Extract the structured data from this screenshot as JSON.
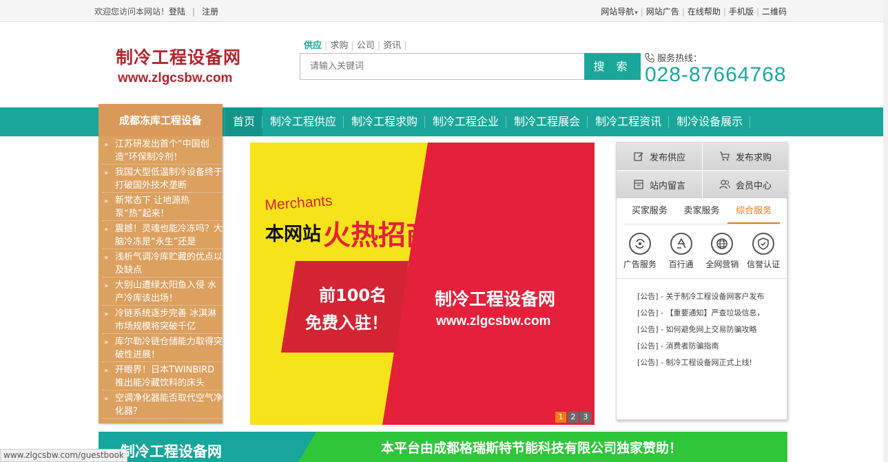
{
  "topbar": {
    "welcome": "欢迎您访问本网站！",
    "login": "登陆",
    "register": "注册",
    "links": [
      "网站导航",
      "网站广告",
      "在线帮助",
      "手机版",
      "二维码"
    ]
  },
  "logo": {
    "title": "制冷工程设备网",
    "url": "www.zlgcsbw.com"
  },
  "search": {
    "tabs": [
      "供应",
      "求购",
      "公司",
      "资讯"
    ],
    "placeholder": "请输入关键词",
    "button": "搜 索"
  },
  "hotline": {
    "label": "服务热线：",
    "number": "028-87664768"
  },
  "nav": {
    "items": [
      "首页",
      "制冷工程供应",
      "制冷工程求购",
      "制冷工程企业",
      "制冷工程展会",
      "制冷工程资讯",
      "制冷设备展示"
    ]
  },
  "sidebar": {
    "title": "成都冻库工程设备",
    "news": [
      "江苏研发出首个“中国创造”环保制冷剂！",
      "我国大型低温制冷设备终于打破国外技术垄断",
      "新常态下 让地源热泵“热”起来！",
      "震撼！灵魂也能冷冻吗？大脑冷冻是“永生”还是",
      "浅析气调冷库贮藏的优点以及缺点",
      "大别山遭绿太阳鱼入侵 水产冷库该出场！",
      "冷链系统逐步完善 冰淇淋市场规模将突破千亿",
      "库尔勒冷链仓储能力取得突破性进展！",
      "开眼界！日本TWINBIRD推出能冷藏饮料的床头",
      "空调净化器能否取代空气净化器？"
    ]
  },
  "banner": {
    "merchants": "Merchants",
    "site_label": "本网站",
    "headline": "火热招商中",
    "offer_line1": "前100名",
    "offer_line2": "免费入驻！",
    "brand": "制冷工程设备网",
    "brand_url": "www.zlgcsbw.com",
    "pages": [
      "1",
      "2",
      "3"
    ]
  },
  "right_panel": {
    "quick_buttons": [
      "发布供应",
      "发布求购",
      "站内留言",
      "会员中心"
    ],
    "tabs": [
      "买家服务",
      "卖家服务",
      "综合服务"
    ],
    "services": [
      "广告服务",
      "百行通",
      "全网营销",
      "信誉认证"
    ],
    "notices": [
      "[公告] - 关于制冷工程设备网客户发布",
      "[公告] - 【重要通知】严查垃圾信息，",
      "[公告] - 如何避免网上交易防骗攻略",
      "[公告] - 消费者防骗指南",
      "[公告] - 制冷工程设备网正式上线!"
    ]
  },
  "bottom_ad": {
    "left_text": "制冷工程设备网",
    "right_text": "本平台由成都格瑞斯特节能科技有限公司独家赞助！"
  },
  "status_url": "www.zlgcsbw.com/guestbook"
}
